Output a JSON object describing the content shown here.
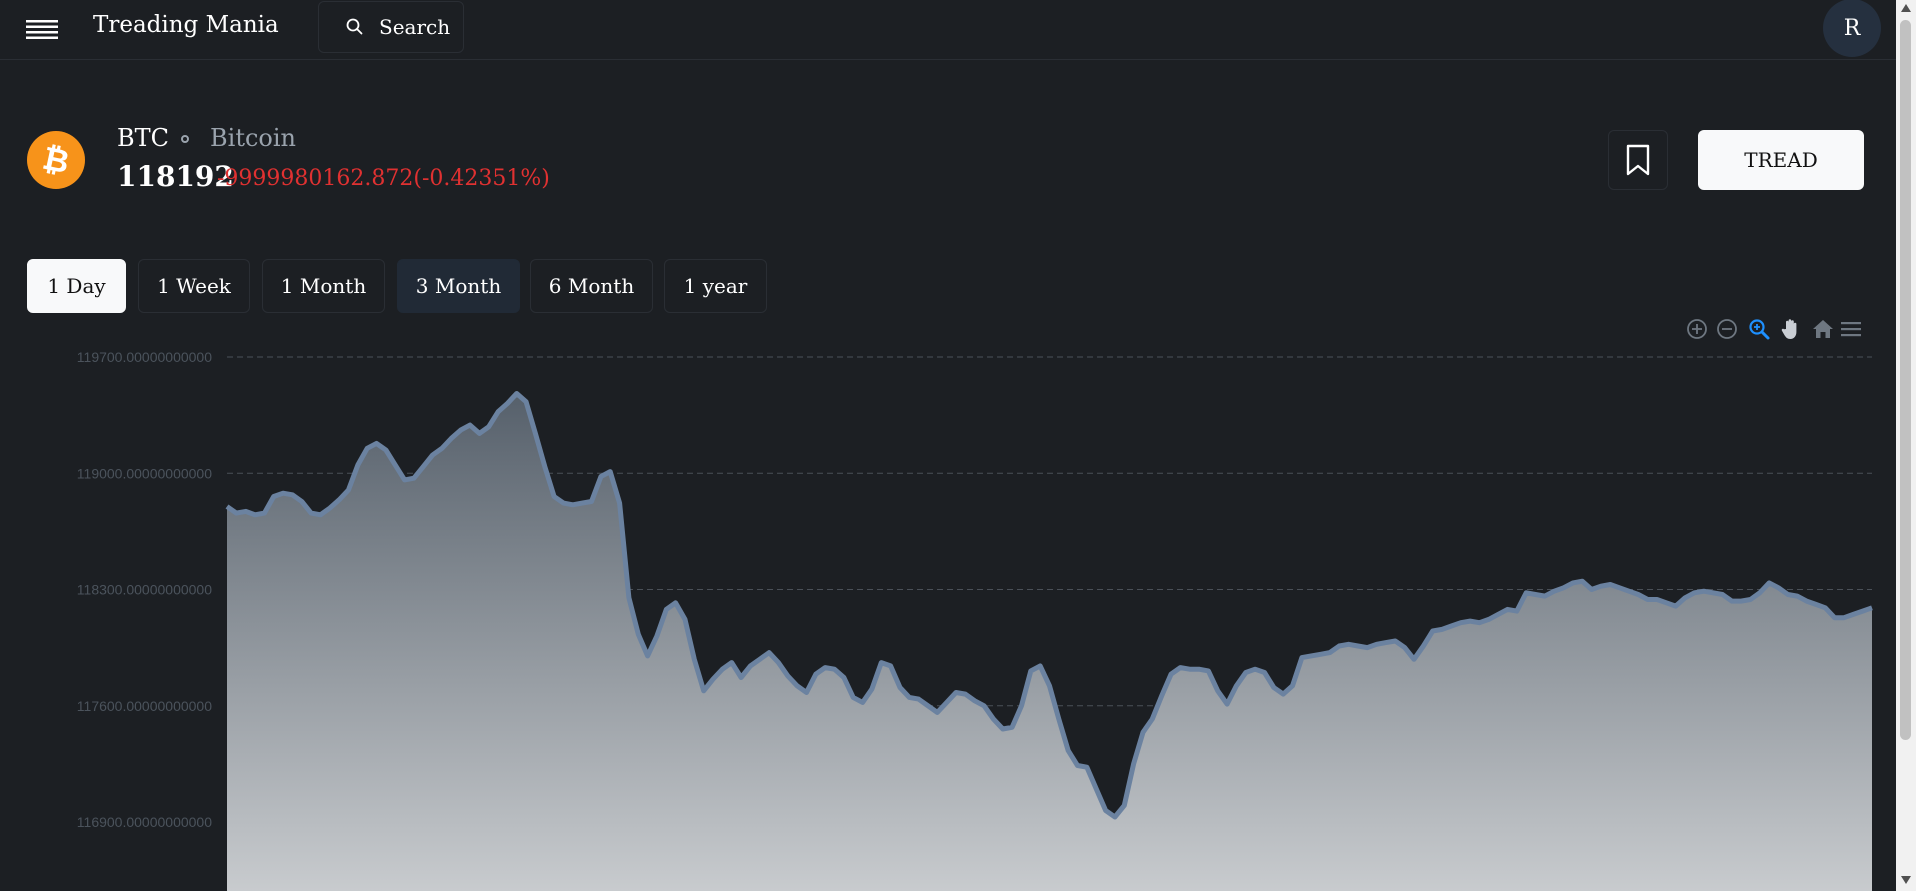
{
  "header": {
    "menu_icon": "hamburger-icon",
    "app_title": "Treading Mania",
    "search_label": "Search",
    "search_icon": "search-icon",
    "avatar_initial": "R"
  },
  "coin": {
    "logo_icon": "bitcoin-icon",
    "logo_color": "#f7931a",
    "symbol": "BTC",
    "name": "Bitcoin",
    "price": "118192",
    "change": "-9999980162.872(-0.42351%)",
    "change_color": "#e03131"
  },
  "actions": {
    "bookmark_icon": "bookmark-icon",
    "trade_label": "TREAD"
  },
  "ranges": {
    "tabs": [
      "1 Day",
      "1 Week",
      "1 Month",
      "3 Month",
      "6 Month",
      "1 year"
    ],
    "selected": "1 Day"
  },
  "toolbar": {
    "icons": [
      "zoom-in-icon",
      "zoom-out-icon",
      "selection-zoom-icon",
      "pan-icon",
      "reset-home-icon",
      "menu-icon"
    ],
    "active_color": "#1e90ff"
  },
  "chart_data": {
    "type": "area",
    "yticks": [
      "119700.00000000000",
      "119000.00000000000",
      "118300.00000000000",
      "117600.00000000000",
      "116900.00000000000"
    ],
    "ytick_values": [
      119700,
      119000,
      118300,
      117600,
      116900
    ],
    "grid": "dashed horizontal",
    "line_color": "#6b82a0",
    "fill_top_color": "#56606b",
    "fill_bottom_color": "#c8cbce",
    "values": [
      118800,
      118760,
      118770,
      118750,
      118760,
      118860,
      118880,
      118870,
      118830,
      118760,
      118750,
      118790,
      118840,
      118900,
      119050,
      119150,
      119180,
      119140,
      119050,
      118960,
      118970,
      119040,
      119110,
      119150,
      119210,
      119260,
      119290,
      119240,
      119280,
      119370,
      119420,
      119480,
      119430,
      119240,
      119040,
      118860,
      118820,
      118810,
      118820,
      118830,
      118980,
      119010,
      118820,
      118250,
      118030,
      117900,
      118020,
      118180,
      118220,
      118120,
      117880,
      117690,
      117760,
      117820,
      117860,
      117770,
      117840,
      117880,
      117920,
      117860,
      117780,
      117720,
      117680,
      117790,
      117830,
      117820,
      117770,
      117650,
      117620,
      117700,
      117860,
      117840,
      117710,
      117650,
      117640,
      117600,
      117560,
      117620,
      117680,
      117670,
      117630,
      117600,
      117520,
      117460,
      117470,
      117600,
      117810,
      117840,
      117720,
      117520,
      117330,
      117240,
      117230,
      117100,
      116970,
      116930,
      117000,
      117250,
      117440,
      117520,
      117660,
      117790,
      117830,
      117820,
      117820,
      117810,
      117690,
      117610,
      117720,
      117800,
      117820,
      117800,
      117710,
      117670,
      117720,
      117890,
      117900,
      117910,
      117920,
      117960,
      117970,
      117960,
      117950,
      117970,
      117980,
      117990,
      117950,
      117880,
      117960,
      118050,
      118060,
      118080,
      118100,
      118110,
      118100,
      118120,
      118150,
      118180,
      118170,
      118280,
      118270,
      118260,
      118290,
      118310,
      118340,
      118350,
      118300,
      118320,
      118330,
      118310,
      118290,
      118270,
      118240,
      118240,
      118220,
      118200,
      118250,
      118280,
      118290,
      118280,
      118270,
      118230,
      118230,
      118240,
      118280,
      118340,
      118310,
      118270,
      118260,
      118230,
      118210,
      118190,
      118130,
      118130,
      118150,
      118170,
      118190
    ]
  }
}
